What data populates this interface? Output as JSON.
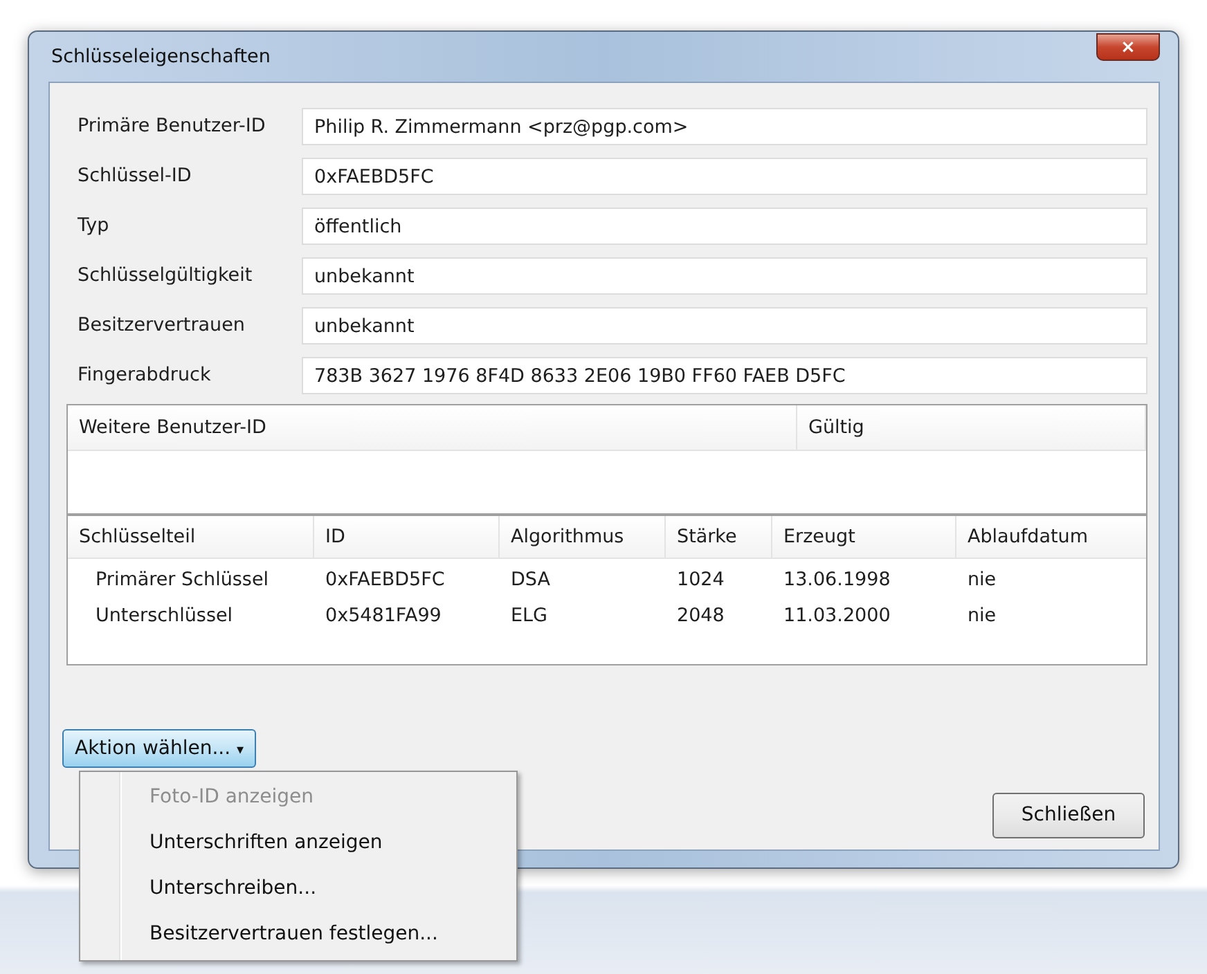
{
  "window": {
    "title": "Schlüsseleigenschaften",
    "close": "×"
  },
  "fields": [
    {
      "label": "Primäre Benutzer-ID",
      "value": "Philip R. Zimmermann <prz@pgp.com>"
    },
    {
      "label": "Schlüssel-ID",
      "value": "0xFAEBD5FC"
    },
    {
      "label": "Typ",
      "value": "öffentlich"
    },
    {
      "label": "Schlüsselgültigkeit",
      "value": "unbekannt"
    },
    {
      "label": "Besitzervertrauen",
      "value": "unbekannt"
    },
    {
      "label": "Fingerabdruck",
      "value": "783B 3627 1976 8F4D 8633 2E06 19B0 FF60 FAEB D5FC"
    }
  ],
  "user_ids": {
    "columns": [
      "Weitere Benutzer-ID",
      "Gültig"
    ]
  },
  "subkeys": {
    "columns": [
      "Schlüsselteil",
      "ID",
      "Algorithmus",
      "Stärke",
      "Erzeugt",
      "Ablaufdatum"
    ],
    "rows": [
      [
        "Primärer Schlüssel",
        "0xFAEBD5FC",
        "DSA",
        "1024",
        "13.06.1998",
        "nie"
      ],
      [
        "Unterschlüssel",
        "0x5481FA99",
        "ELG",
        "2048",
        "11.03.2000",
        "nie"
      ]
    ]
  },
  "action_button": {
    "label": "Aktion wählen...",
    "caret": "▾"
  },
  "menu": [
    {
      "label": "Foto-ID anzeigen",
      "disabled": true
    },
    {
      "label": "Unterschriften anzeigen",
      "disabled": false
    },
    {
      "label": "Unterschreiben...",
      "disabled": false
    },
    {
      "label": "Besitzervertrauen festlegen...",
      "disabled": false
    }
  ],
  "close_button": {
    "label": "Schließen"
  }
}
